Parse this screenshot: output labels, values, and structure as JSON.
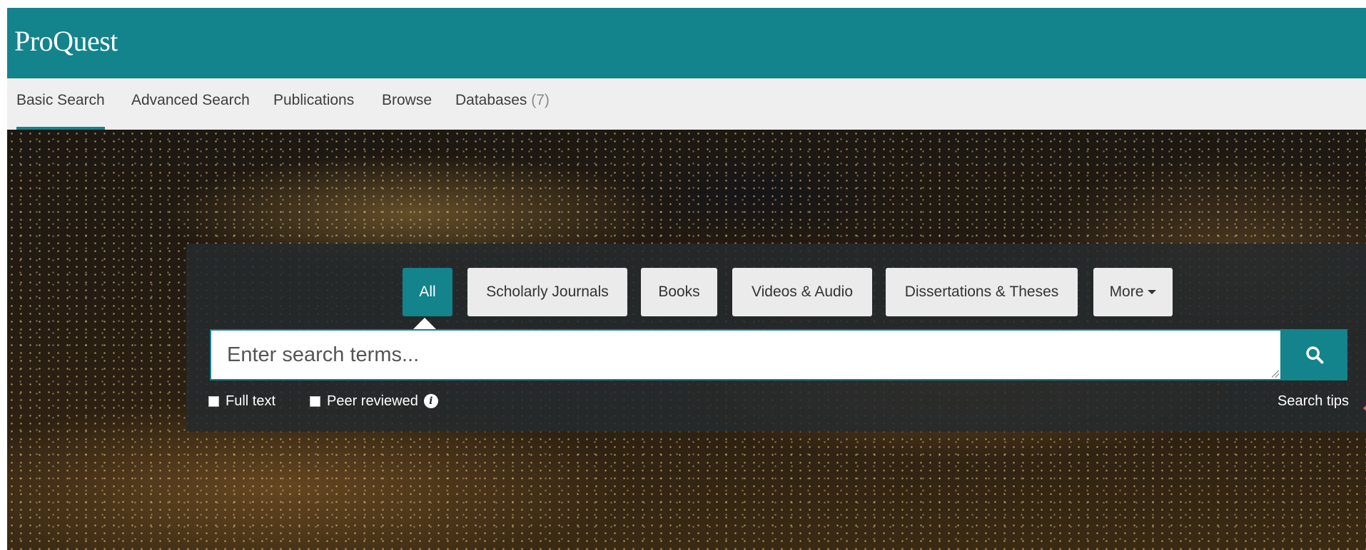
{
  "header": {
    "logo": "ProQuest"
  },
  "nav": {
    "items": [
      {
        "label": "Basic Search"
      },
      {
        "label": "Advanced Search"
      },
      {
        "label": "Publications"
      },
      {
        "label": "Browse"
      },
      {
        "label": "Databases",
        "count": "(7)"
      }
    ]
  },
  "search": {
    "source_types": [
      "All",
      "Scholarly Journals",
      "Books",
      "Videos & Audio",
      "Dissertations & Theses"
    ],
    "more_label": "More",
    "placeholder": "Enter search terms...",
    "options": {
      "full_text": "Full text",
      "peer_reviewed": "Peer reviewed"
    },
    "tips_label": "Search tips"
  },
  "colors": {
    "brand": "#13838c",
    "nav_bg": "#efefef",
    "panel": "#262a2c"
  },
  "icons": [
    "search-icon",
    "info-icon",
    "caret-down-icon"
  ]
}
